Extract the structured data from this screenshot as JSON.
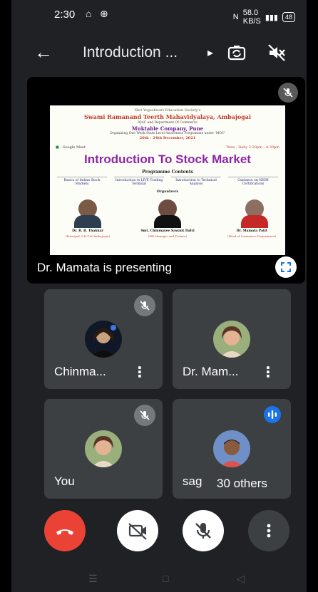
{
  "status_bar": {
    "time": "2:30",
    "speed_top": "58.0",
    "speed_unit": "KB/S",
    "battery": "48"
  },
  "header": {
    "title": "Introduction ...",
    "back_icon": "arrow-left-icon",
    "play_icon": "triangle-right-icon"
  },
  "presentation": {
    "presenter_label": "Dr. Mamata is presenting",
    "slide": {
      "line1": "Shri Yogeshwari Education Society's",
      "college": "Swami Ramanand Teerth Mahavidyalaya, Ambajogai",
      "line3": "IQAC and Department Of Commerce",
      "line3b": "In Collaboration with",
      "company": "Muktable Company, Pune",
      "line5": "Organizing One Week State Level Awareness Programme under 'MOU'",
      "dates": "20th - 24th December, 2021",
      "platform": "Google Meet",
      "time": "Time : Daily 2:30pm - 4:30pm",
      "heading": "Introduction To Stock Market",
      "contents_label": "Programme Contents",
      "topics": [
        "Basics of Indian Stock Markets",
        "Introduction to LIVE Trading Terminal",
        "Introduction to Technical Analysis",
        "Guidance on NISM Certifications"
      ],
      "organizers_label": "Organizers",
      "organizers": [
        {
          "name": "Dr. R. R. Thakkar",
          "role": "(Principal, S.R.T.M Ambajogai)"
        },
        {
          "name": "Smt. Chinmayee Sawant Dalvi",
          "role": "(HR Manager and Trainer)"
        },
        {
          "name": "Dr. Mamata Patil",
          "role": "(Head of Commerce Department)"
        }
      ]
    }
  },
  "participants": [
    {
      "name": "Chinma...",
      "muted": true
    },
    {
      "name": "Dr. Mam...",
      "muted": false
    },
    {
      "name": "You",
      "muted": true
    },
    {
      "name": "sag",
      "speaking": true,
      "others": "30 others"
    }
  ],
  "colors": {
    "end_call": "#ea4335",
    "tile": "#3c4043",
    "background": "#202124",
    "speaking": "#1a73e8"
  }
}
